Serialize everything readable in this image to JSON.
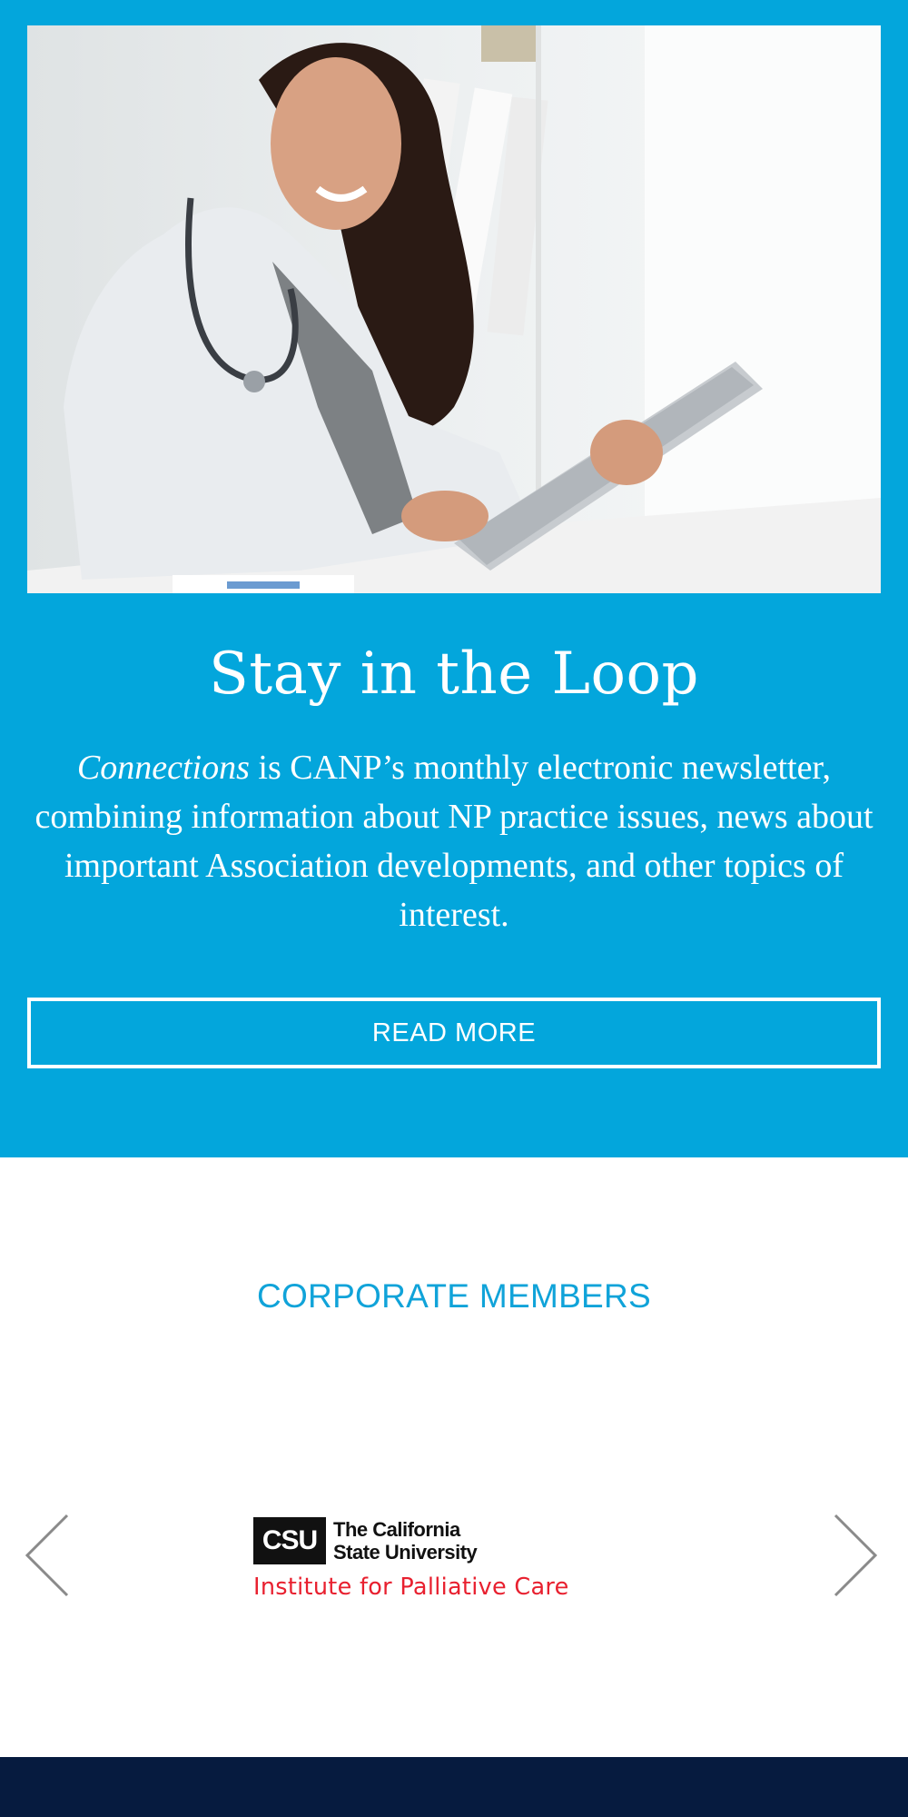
{
  "hero": {
    "image_description": "Smiling nurse practitioner in white coat with stethoscope using a tablet"
  },
  "loop": {
    "title": "Stay in the Loop",
    "text_emphasis": "Connections",
    "text_body": " is CANP’s monthly electronic newsletter, combining information about NP practice issues, news about important Association developments, and other topics of interest.",
    "button_label": "READ MORE"
  },
  "corporate": {
    "heading": "CORPORATE MEMBERS",
    "logo": {
      "box_text": "CSU",
      "line1": "The California",
      "line2": "State University",
      "line3": "Institute for Palliative Care"
    },
    "prev_icon": "chevron-left-icon",
    "next_icon": "chevron-right-icon"
  },
  "colors": {
    "primary_blue": "#03a6dc",
    "heading_blue": "#10a3d9",
    "footer_navy": "#061b3f",
    "logo_red": "#e8202f"
  }
}
